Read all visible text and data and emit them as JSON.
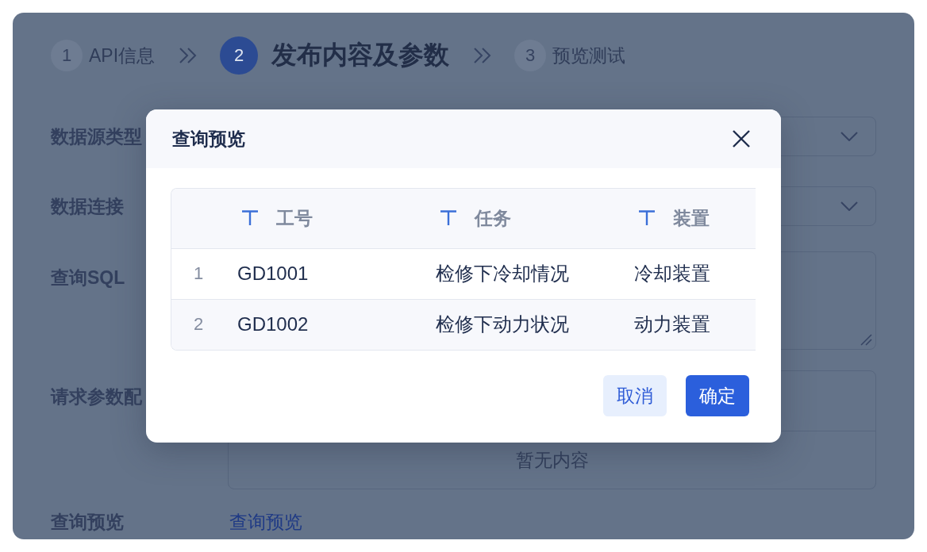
{
  "steps": [
    {
      "number": "1",
      "label": "API信息",
      "selected": false
    },
    {
      "number": "2",
      "label": "发布内容及参数",
      "selected": true
    },
    {
      "number": "3",
      "label": "预览测试",
      "selected": false
    }
  ],
  "form": {
    "fields": [
      {
        "label": "数据源类型",
        "kind": "select"
      },
      {
        "label": "数据连接",
        "kind": "select"
      },
      {
        "label": "查询SQL",
        "kind": "textarea"
      },
      {
        "label": "请求参数配",
        "kind": "table",
        "empty_text": "暂无内容"
      },
      {
        "label": "查询预览",
        "kind": "link",
        "link": "查询预览"
      }
    ]
  },
  "dialog": {
    "title": "查询预览",
    "table": {
      "columns": [
        "工号",
        "任务",
        "装置"
      ],
      "rows": [
        {
          "index": "1",
          "cells": [
            "GD1001",
            "检修下冷却情况",
            "冷却装置"
          ]
        },
        {
          "index": "2",
          "cells": [
            "GD1002",
            "检修下动力状况",
            "动力装置"
          ]
        }
      ]
    },
    "buttons": [
      {
        "label": "取消",
        "kind": "secondary"
      },
      {
        "label": "确定",
        "kind": "primary"
      }
    ]
  }
}
